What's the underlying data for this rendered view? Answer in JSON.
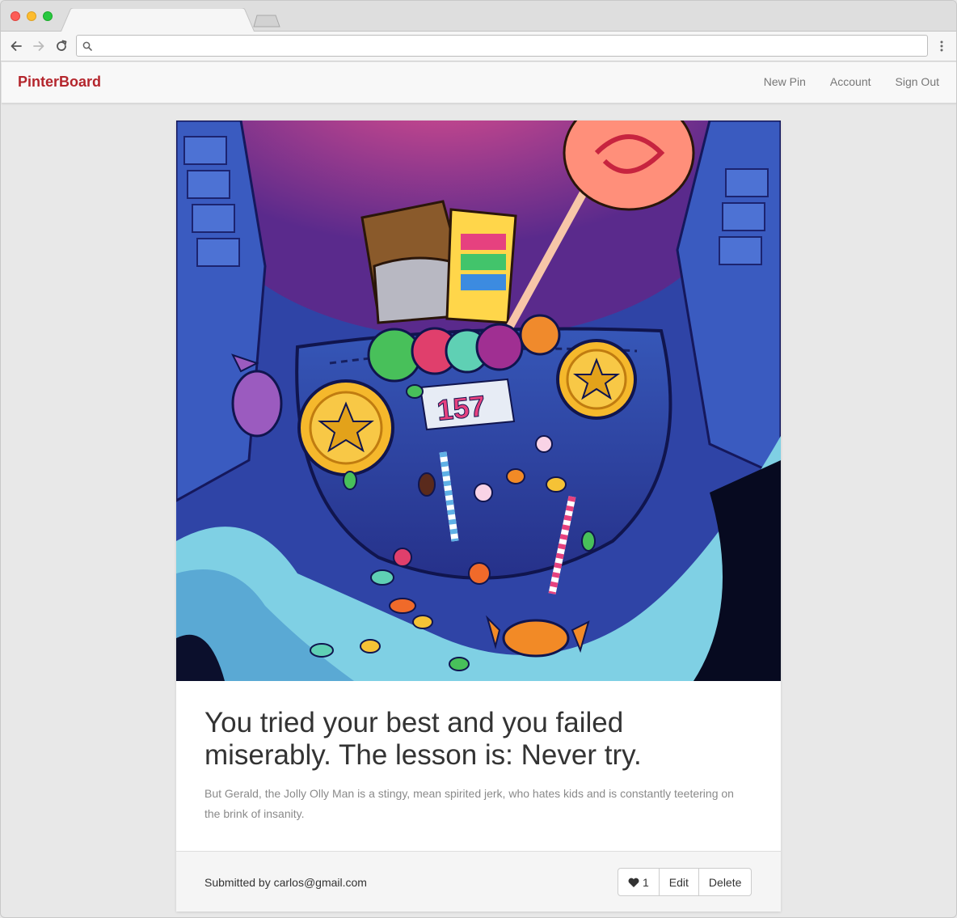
{
  "browser": {
    "tab_title": "",
    "address_value": "",
    "address_placeholder": ""
  },
  "app": {
    "brand": "PinterBoard",
    "brand_color": "#b4262d",
    "nav": {
      "new_pin": "New Pin",
      "account": "Account",
      "sign_out": "Sign Out"
    }
  },
  "pin": {
    "image_icon": "candy-pocket-illustration",
    "image_number_label": "157",
    "title": "You tried your best and you failed miserably. The lesson is: Never try.",
    "description": "But Gerald, the Jolly Olly Man is a stingy, mean spirited jerk, who hates kids and is constantly teetering on the brink of insanity.",
    "submitted_by": "Submitted by carlos@gmail.com",
    "like_count": "1",
    "edit_label": "Edit",
    "delete_label": "Delete"
  }
}
